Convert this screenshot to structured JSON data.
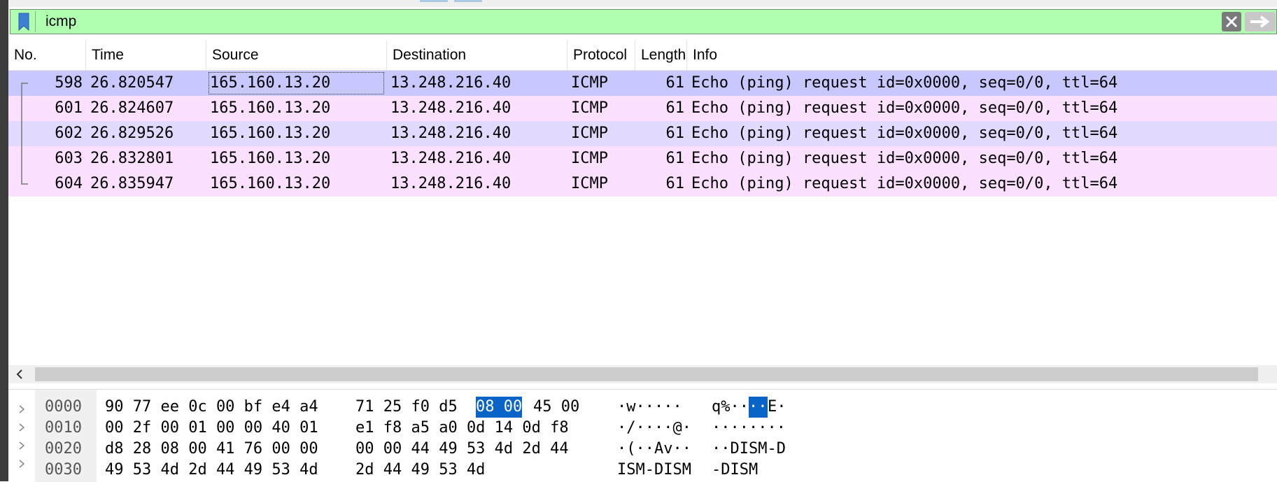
{
  "filter": {
    "value": "icmp",
    "bg_color": "#b0ffb0"
  },
  "columns": [
    {
      "label": "No."
    },
    {
      "label": "Time"
    },
    {
      "label": "Source"
    },
    {
      "label": "Destination"
    },
    {
      "label": "Protocol"
    },
    {
      "label": "Length"
    },
    {
      "label": "Info"
    }
  ],
  "packets": [
    {
      "no": "598",
      "time": "26.820547",
      "source": "165.160.13.20",
      "destination": "13.248.216.40",
      "protocol": "ICMP",
      "length": "61",
      "info": "Echo (ping) request  id=0x0000, seq=0/0, ttl=64",
      "bg": "#c8c8ff",
      "selected": true
    },
    {
      "no": "601",
      "time": "26.824607",
      "source": "165.160.13.20",
      "destination": "13.248.216.40",
      "protocol": "ICMP",
      "length": "61",
      "info": "Echo (ping) request  id=0x0000, seq=0/0, ttl=64",
      "bg": "#fce0ff"
    },
    {
      "no": "602",
      "time": "26.829526",
      "source": "165.160.13.20",
      "destination": "13.248.216.40",
      "protocol": "ICMP",
      "length": "61",
      "info": "Echo (ping) request  id=0x0000, seq=0/0, ttl=64",
      "bg": "#e4daff"
    },
    {
      "no": "603",
      "time": "26.832801",
      "source": "165.160.13.20",
      "destination": "13.248.216.40",
      "protocol": "ICMP",
      "length": "61",
      "info": "Echo (ping) request  id=0x0000, seq=0/0, ttl=64",
      "bg": "#fce0ff"
    },
    {
      "no": "604",
      "time": "26.835947",
      "source": "165.160.13.20",
      "destination": "13.248.216.40",
      "protocol": "ICMP",
      "length": "61",
      "info": "Echo (ping) request  id=0x0000, seq=0/0, ttl=64",
      "bg": "#fce0ff"
    }
  ],
  "bytes": [
    {
      "offset": "0000",
      "hex_a": "90 77 ee 0c 00 bf e4 a4",
      "hex_b_pre": "71 25 f0 d5",
      "hex_b_hl": "08 00",
      "hex_b_post": "45 00",
      "ascii_a": "·w·····",
      "ascii_b_pre": "q%··",
      "ascii_b_hl": "··",
      "ascii_b_post": "E·"
    },
    {
      "offset": "0010",
      "hex_a": "00 2f 00 01 00 00 40 01",
      "hex_b_pre": "e1 f8 a5 a0 0d 14 0d f8",
      "hex_b_hl": "",
      "hex_b_post": "",
      "ascii_a": "·/····@·",
      "ascii_b_pre": "········",
      "ascii_b_hl": "",
      "ascii_b_post": ""
    },
    {
      "offset": "0020",
      "hex_a": "d8 28 08 00 41 76 00 00",
      "hex_b_pre": "00 00 44 49 53 4d 2d 44",
      "hex_b_hl": "",
      "hex_b_post": "",
      "ascii_a": "·(··Av··",
      "ascii_b_pre": "··DISM-D",
      "ascii_b_hl": "",
      "ascii_b_post": ""
    },
    {
      "offset": "0030",
      "hex_a": "49 53 4d 2d 44 49 53 4d",
      "hex_b_pre": "2d 44 49 53 4d",
      "hex_b_hl": "",
      "hex_b_post": "",
      "ascii_a": "ISM-DISM",
      "ascii_b_pre": "-DISM",
      "ascii_b_hl": "",
      "ascii_b_post": ""
    }
  ],
  "colors": {
    "selected_row": "#c8c8ff",
    "icmp_row": "#fce0ff",
    "byte_highlight": "#0a64c8"
  },
  "icons": {
    "bookmark": "bookmark-icon",
    "clear": "clear-x-icon",
    "apply": "apply-arrow-icon",
    "scroll_left": "chevron-left-icon",
    "expand": "chevron-right-icon"
  }
}
